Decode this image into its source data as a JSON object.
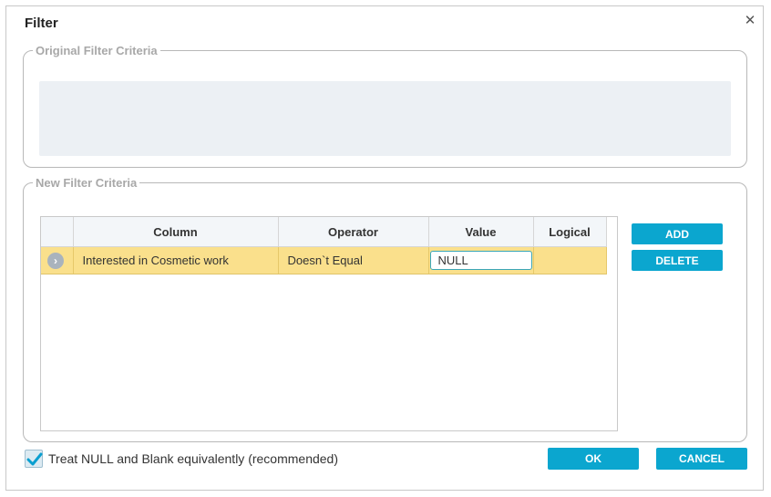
{
  "dialog": {
    "title": "Filter",
    "close_icon": "close-icon"
  },
  "original": {
    "legend": "Original Filter Criteria"
  },
  "new_criteria": {
    "legend": "New Filter Criteria",
    "columns": [
      "Column",
      "Operator",
      "Value",
      "Logical"
    ],
    "rows": [
      {
        "column": "Interested in Cosmetic work",
        "operator": "Doesn`t Equal",
        "value": "NULL",
        "logical": ""
      }
    ],
    "add_label": "ADD",
    "delete_label": "DELETE"
  },
  "footer": {
    "checkbox_label": "Treat NULL and Blank equivalently (recommended)",
    "checkbox_checked": true,
    "ok_label": "OK",
    "cancel_label": "CANCEL"
  },
  "colors": {
    "accent": "#0ba6cf",
    "selected_row": "#fae08c",
    "input_border": "#3aa6b8"
  }
}
